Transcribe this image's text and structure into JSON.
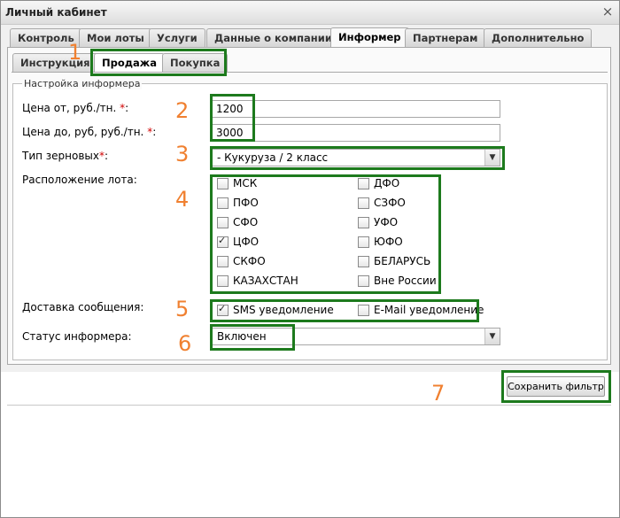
{
  "window": {
    "title": "Личный кабинет"
  },
  "tabs": [
    "Контроль",
    "Мои лоты",
    "Услуги",
    "Данные о компании",
    "Информер",
    "Партнерам",
    "Дополнительно"
  ],
  "subtabs": [
    "Инструкция",
    "Продажа",
    "Покупка"
  ],
  "fieldset_legend": "Настройка информера",
  "form": {
    "price_from_label": "Цена от, руб./тн.",
    "price_from_value": "1200",
    "price_to_label": "Цена до, руб, руб./тн.",
    "price_to_value": "3000",
    "grain_type_label": "Тип зерновых",
    "grain_type_value": "- Кукуруза / 2 класс",
    "required_mark": "*",
    "colon": ":",
    "location_label": "Расположение лота:",
    "locations": [
      {
        "label": "МСК",
        "checked": false
      },
      {
        "label": "ДФО",
        "checked": false
      },
      {
        "label": "ПФО",
        "checked": false
      },
      {
        "label": "СЗФО",
        "checked": false
      },
      {
        "label": "СФО",
        "checked": false
      },
      {
        "label": "УФО",
        "checked": false
      },
      {
        "label": "ЦФО",
        "checked": true
      },
      {
        "label": "ЮФО",
        "checked": false
      },
      {
        "label": "СКФО",
        "checked": false
      },
      {
        "label": "БЕЛАРУСЬ",
        "checked": false
      },
      {
        "label": "КАЗАХСТАН",
        "checked": false
      },
      {
        "label": "Вне России",
        "checked": false
      }
    ],
    "delivery_label": "Доставка сообщения:",
    "delivery_sms": "SMS уведомление",
    "delivery_email": "E-Mail уведомление",
    "status_label": "Статус информера:",
    "status_value": "Включен"
  },
  "save_button": "Сохранить фильтр",
  "markers": [
    "1",
    "2",
    "3",
    "4",
    "5",
    "6",
    "7"
  ],
  "colors": {
    "highlight": "#1d7a1d",
    "marker": "#f08030",
    "required": "#d00000"
  },
  "icons": {
    "close": "close-icon",
    "dropdown": "chevron-down-icon"
  }
}
